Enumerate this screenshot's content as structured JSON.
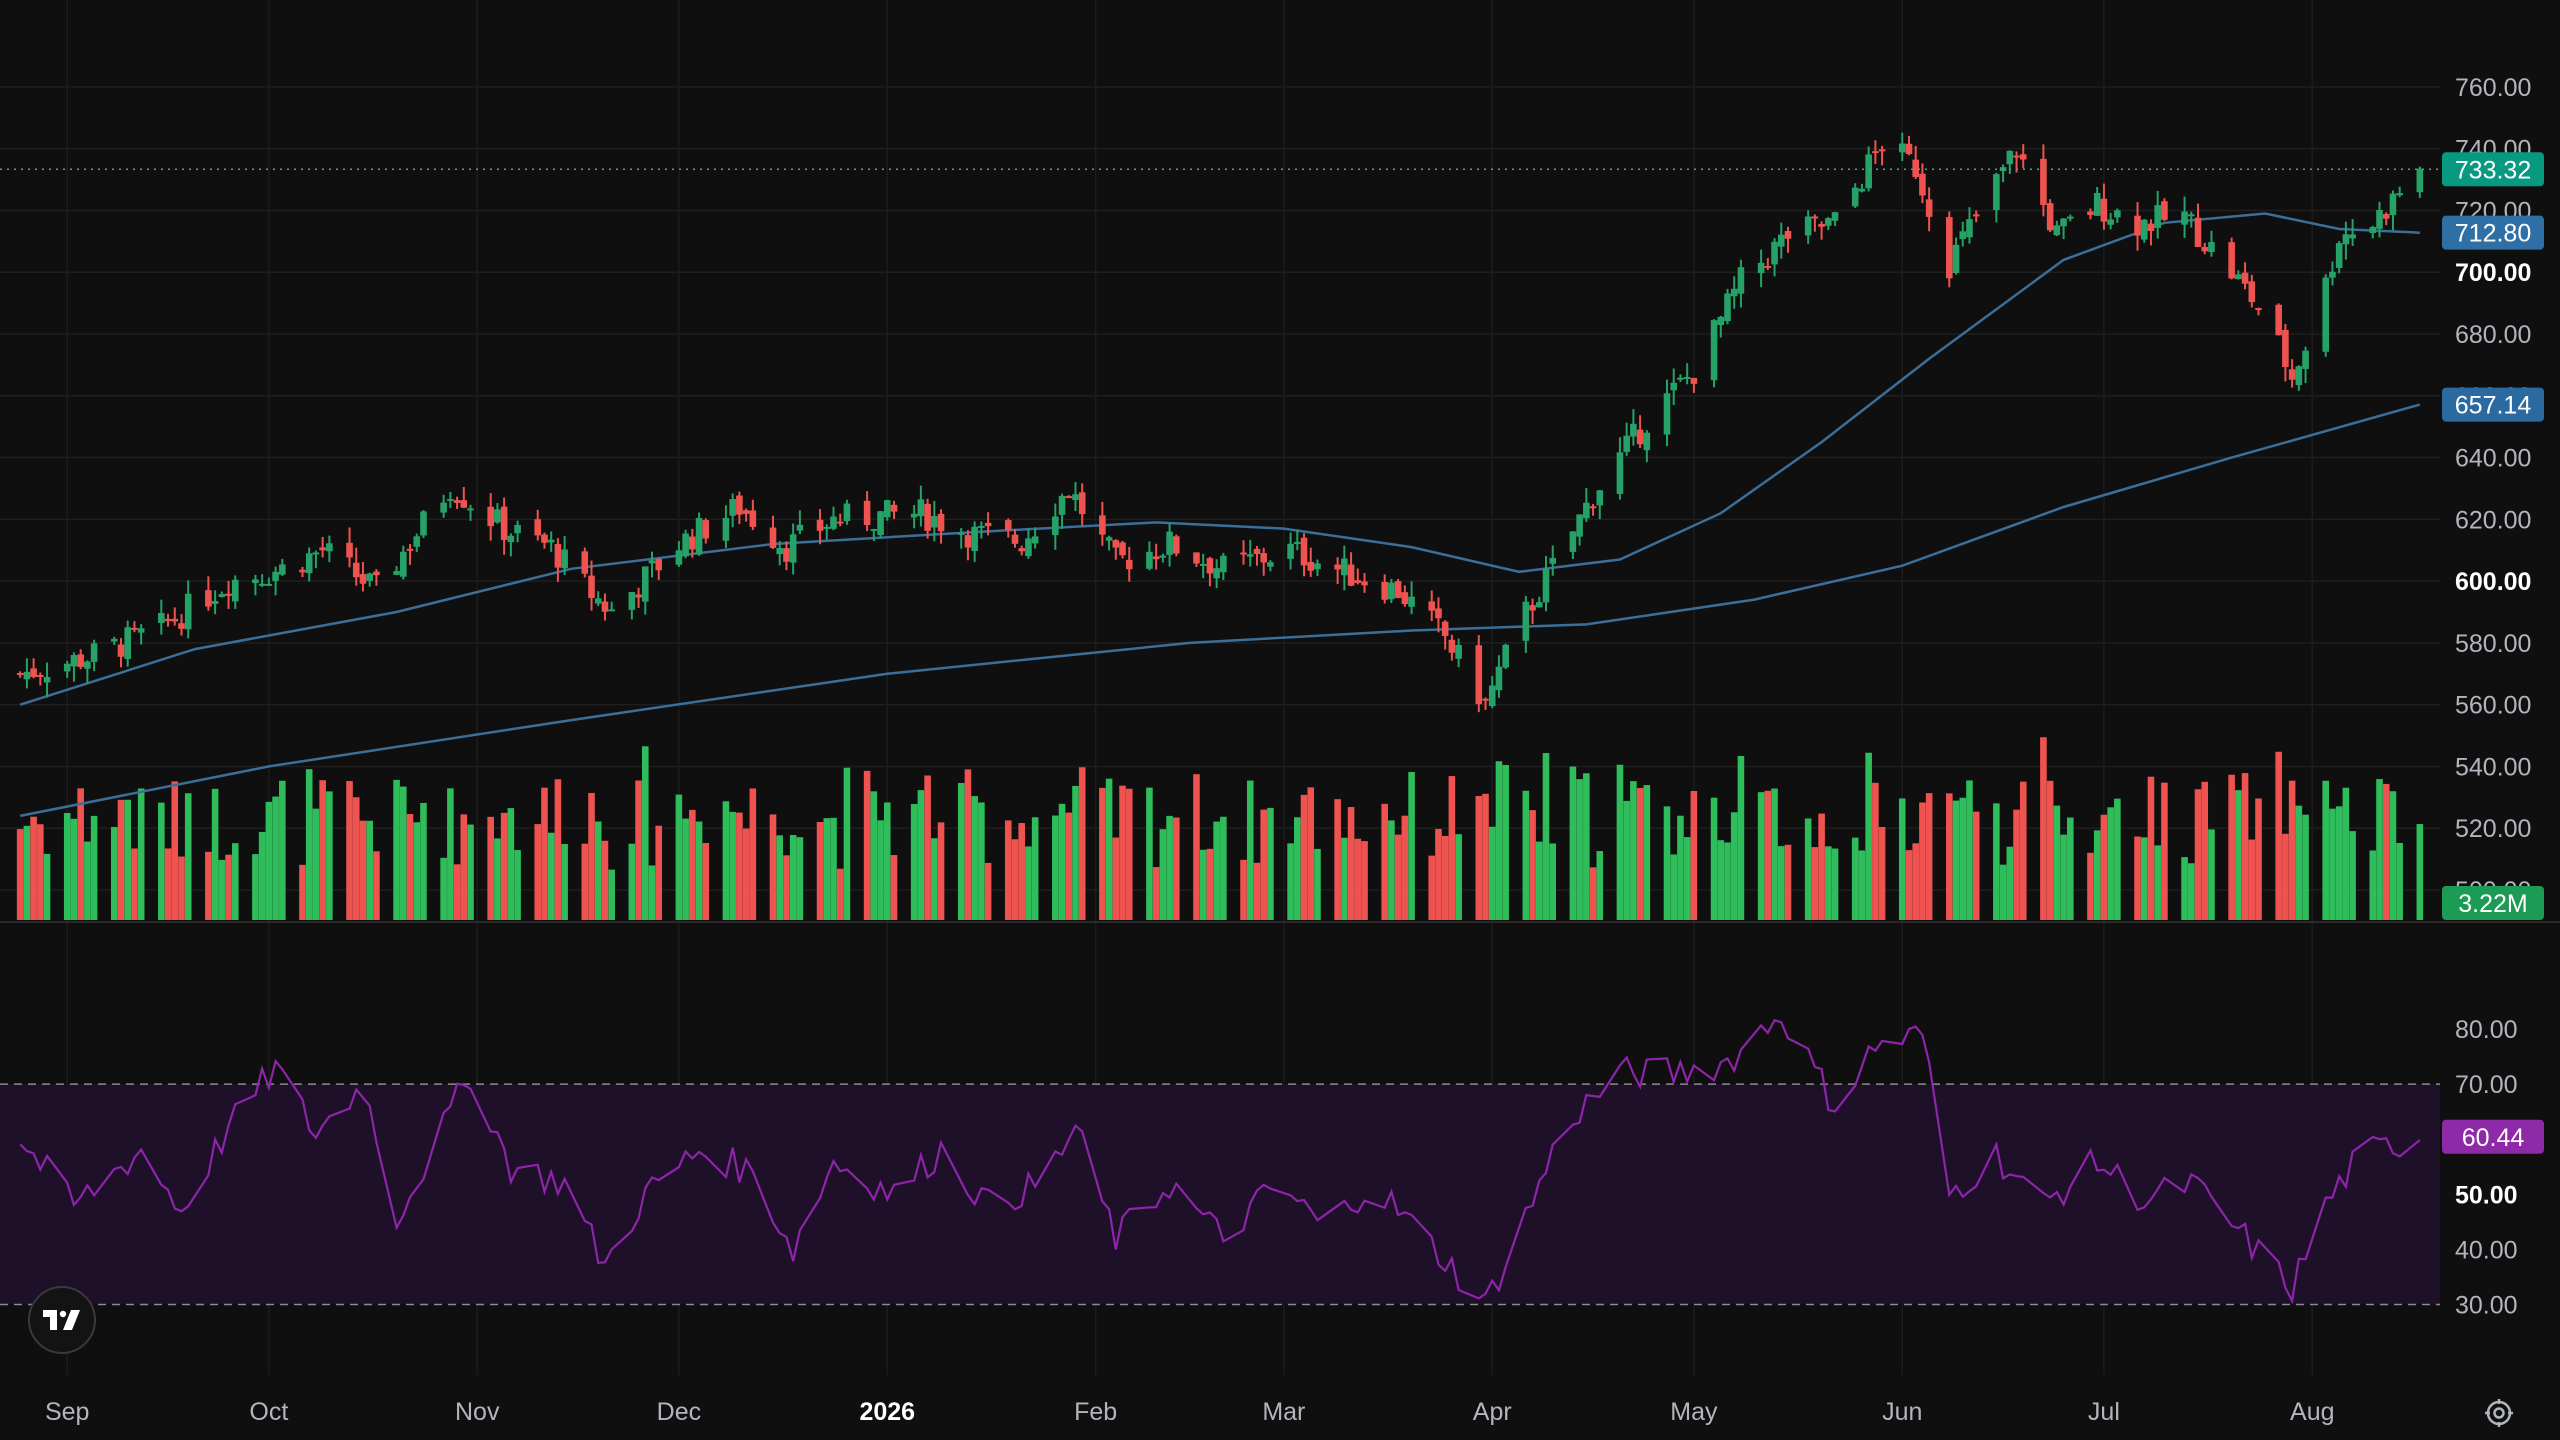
{
  "chart_data": {
    "type": "candlestick",
    "price_ticks": [
      "760.00",
      "740.00",
      "720.00",
      "700.00",
      "680.00",
      "660.00",
      "640.00",
      "620.00",
      "600.00",
      "580.00",
      "560.00",
      "540.00",
      "520.00",
      "500.00"
    ],
    "price_ticks_bold": [
      "700.00",
      "600.00"
    ],
    "rsi_ticks": [
      "80.00",
      "70.00",
      "50.00",
      "40.00",
      "30.00"
    ],
    "rsi_ticks_bold": [
      "50.00"
    ],
    "x_labels": [
      "Sep",
      "Oct",
      "Nov",
      "Dec",
      "2026",
      "Feb",
      "Mar",
      "Apr",
      "May",
      "Jun",
      "Jul",
      "Aug"
    ],
    "x_labels_bold": [
      "2026"
    ],
    "price_range": [
      500,
      770
    ],
    "rsi_range": [
      25,
      88
    ],
    "rsi_bands": [
      30,
      70
    ],
    "last_price": 733.32,
    "ma_fast_last": 712.8,
    "ma_slow_last": 657.14,
    "last_volume": "3.22M",
    "rsi_last": 60.44,
    "price_path": [
      [
        "2025-08-25",
        570
      ],
      [
        "2025-09-05",
        576
      ],
      [
        "2025-09-15",
        585
      ],
      [
        "2025-09-25",
        600
      ],
      [
        "2025-10-03",
        604
      ],
      [
        "2025-10-09",
        610
      ],
      [
        "2025-10-17",
        597
      ],
      [
        "2025-10-28",
        631
      ],
      [
        "2025-11-05",
        617
      ],
      [
        "2025-11-12",
        611
      ],
      [
        "2025-11-18",
        596
      ],
      [
        "2025-11-21",
        590
      ],
      [
        "2025-12-01",
        612
      ],
      [
        "2025-12-10",
        624
      ],
      [
        "2025-12-17",
        611
      ],
      [
        "2025-12-24",
        620
      ],
      [
        "2026-01-06",
        622
      ],
      [
        "2026-01-14",
        615
      ],
      [
        "2026-01-21",
        613
      ],
      [
        "2026-01-28",
        630
      ],
      [
        "2026-02-04",
        606
      ],
      [
        "2026-02-12",
        612
      ],
      [
        "2026-02-20",
        604
      ],
      [
        "2026-03-02",
        610
      ],
      [
        "2026-03-10",
        603
      ],
      [
        "2026-03-18",
        597
      ],
      [
        "2026-03-25",
        582
      ],
      [
        "2026-03-31",
        560
      ],
      [
        "2026-04-05",
        586
      ],
      [
        "2026-04-10",
        604
      ],
      [
        "2026-04-16",
        628
      ],
      [
        "2026-04-24",
        652
      ],
      [
        "2026-05-01",
        668
      ],
      [
        "2026-05-08",
        697
      ],
      [
        "2026-05-15",
        712
      ],
      [
        "2026-05-22",
        716
      ],
      [
        "2026-05-29",
        742
      ],
      [
        "2026-06-03",
        734
      ],
      [
        "2026-06-08",
        703
      ],
      [
        "2026-06-12",
        718
      ],
      [
        "2026-06-18",
        740
      ],
      [
        "2026-06-24",
        712
      ],
      [
        "2026-06-30",
        722
      ],
      [
        "2026-07-06",
        716
      ],
      [
        "2026-07-13",
        718
      ],
      [
        "2026-07-20",
        700
      ],
      [
        "2026-07-25",
        686
      ],
      [
        "2026-07-29",
        666
      ],
      [
        "2026-08-02",
        688
      ],
      [
        "2026-08-05",
        712
      ],
      [
        "2026-08-10",
        716
      ],
      [
        "2026-08-17",
        733.32
      ]
    ],
    "ma_fast": [
      [
        "2025-08-25",
        560
      ],
      [
        "2025-09-20",
        578
      ],
      [
        "2025-10-20",
        590
      ],
      [
        "2025-11-15",
        604
      ],
      [
        "2025-12-15",
        612
      ],
      [
        "2026-01-15",
        616
      ],
      [
        "2026-02-10",
        619
      ],
      [
        "2026-03-01",
        617
      ],
      [
        "2026-03-20",
        611
      ],
      [
        "2026-04-05",
        603
      ],
      [
        "2026-04-20",
        607
      ],
      [
        "2026-05-05",
        622
      ],
      [
        "2026-05-20",
        645
      ],
      [
        "2026-06-05",
        672
      ],
      [
        "2026-06-25",
        704
      ],
      [
        "2026-07-10",
        716
      ],
      [
        "2026-07-25",
        719
      ],
      [
        "2026-08-05",
        714
      ],
      [
        "2026-08-17",
        712.8
      ]
    ],
    "ma_slow": [
      [
        "2025-08-25",
        524
      ],
      [
        "2025-10-01",
        540
      ],
      [
        "2025-11-15",
        555
      ],
      [
        "2026-01-01",
        570
      ],
      [
        "2026-02-15",
        580
      ],
      [
        "2026-03-20",
        584
      ],
      [
        "2026-04-15",
        586
      ],
      [
        "2026-05-10",
        594
      ],
      [
        "2026-06-01",
        605
      ],
      [
        "2026-06-25",
        624
      ],
      [
        "2026-07-20",
        640
      ],
      [
        "2026-08-17",
        657.14
      ]
    ],
    "rsi_path": [
      [
        "2025-08-25",
        60
      ],
      [
        "2025-09-02",
        48
      ],
      [
        "2025-09-12",
        58
      ],
      [
        "2025-09-18",
        47
      ],
      [
        "2025-09-25",
        62
      ],
      [
        "2025-10-02",
        73
      ],
      [
        "2025-10-08",
        61
      ],
      [
        "2025-10-15",
        70
      ],
      [
        "2025-10-20",
        46
      ],
      [
        "2025-10-24",
        55
      ],
      [
        "2025-10-31",
        72
      ],
      [
        "2025-11-06",
        55
      ],
      [
        "2025-11-14",
        52
      ],
      [
        "2025-11-20",
        37
      ],
      [
        "2025-11-26",
        50
      ],
      [
        "2025-12-04",
        58
      ],
      [
        "2025-12-12",
        54
      ],
      [
        "2025-12-18",
        40
      ],
      [
        "2025-12-24",
        56
      ],
      [
        "2026-01-02",
        50
      ],
      [
        "2026-01-09",
        58
      ],
      [
        "2026-01-16",
        48
      ],
      [
        "2026-01-24",
        52
      ],
      [
        "2026-01-29",
        62
      ],
      [
        "2026-02-04",
        42
      ],
      [
        "2026-02-12",
        52
      ],
      [
        "2026-02-20",
        42
      ],
      [
        "2026-02-28",
        52
      ],
      [
        "2026-03-07",
        44
      ],
      [
        "2026-03-14",
        52
      ],
      [
        "2026-03-22",
        42
      ],
      [
        "2026-03-31",
        30
      ],
      [
        "2026-04-06",
        46
      ],
      [
        "2026-04-12",
        63
      ],
      [
        "2026-04-20",
        72
      ],
      [
        "2026-04-28",
        72
      ],
      [
        "2026-05-06",
        74
      ],
      [
        "2026-05-14",
        83
      ],
      [
        "2026-05-22",
        66
      ],
      [
        "2026-05-28",
        77
      ],
      [
        "2026-06-04",
        79
      ],
      [
        "2026-06-08",
        50
      ],
      [
        "2026-06-15",
        57
      ],
      [
        "2026-06-22",
        48
      ],
      [
        "2026-06-30",
        56
      ],
      [
        "2026-07-07",
        49
      ],
      [
        "2026-07-14",
        52
      ],
      [
        "2026-07-22",
        42
      ],
      [
        "2026-07-29",
        33
      ],
      [
        "2026-08-03",
        48
      ],
      [
        "2026-08-08",
        57
      ],
      [
        "2026-08-17",
        60.44
      ]
    ]
  },
  "badges": {
    "last_price": "733.32",
    "ma_fast": "712.80",
    "ma_slow": "657.14",
    "volume": "3.22M",
    "rsi": "60.44"
  },
  "colors": {
    "background": "#0f0f0f",
    "up": "#26a269",
    "up_volume": "#2ebd5a",
    "down": "#ef5350",
    "ma": "#3b6f99",
    "rsi_line": "#8e24aa",
    "rsi_band_fill": "#1e1028",
    "last_price_badge": "#089981",
    "ma_fast_badge": "#2f6fa6",
    "ma_slow_badge": "#2a6aa1",
    "rsi_badge": "#8e2aa8",
    "volume_badge": "#1b9b54"
  },
  "icons": {
    "logo": "tradingview-logo-icon",
    "settings": "gear-icon"
  }
}
